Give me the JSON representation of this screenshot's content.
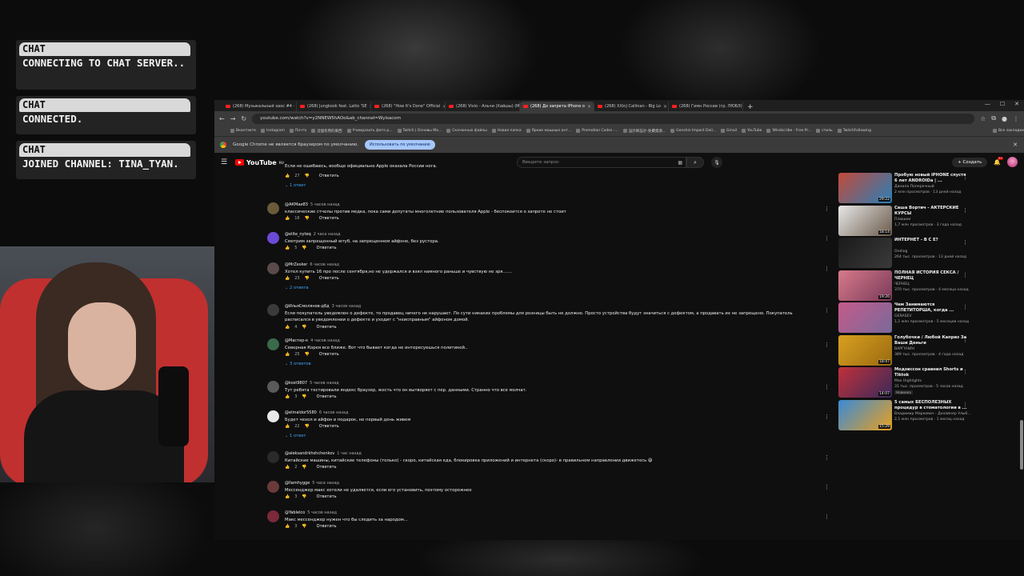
{
  "chat": [
    {
      "tag": "CHAT",
      "message": "CONNECTING TO CHAT SERVER.."
    },
    {
      "tag": "CHAT",
      "message": "CONNECTED."
    },
    {
      "tag": "CHAT",
      "message": "JOINED CHANNEL: TINA_TYAN."
    }
  ],
  "browser": {
    "tabs": [
      {
        "label": "(268) Музыкальный хаос #4 ·"
      },
      {
        "label": "(268) Jungkook feat. Latto 'SE"
      },
      {
        "label": "(268) \"How It's Done\" Official"
      },
      {
        "label": "(268) Vivio - Альчи (Хайшы) (M"
      },
      {
        "label": "(268) До запрета iPhone о"
      },
      {
        "label": "(268) XXinJ Callinan - Big Lo"
      },
      {
        "label": "(268) Гимн России (гр. ЛЮБЭ)"
      }
    ],
    "active_tab": 4,
    "url": "youtube.com/watch?v=y2NNEW5hAOo&ab_channel=Wylsacom",
    "bookmarks": [
      "Вконтакте",
      "Instagram",
      "Почта",
      "這個有用的東西",
      "Учимразить фото р...",
      "Twitch | Основы Ма...",
      "Скачанные файлы",
      "Новая папка",
      "Яркие мощные ант...",
      "Promotion Codes -...",
      "設計師設計-免費資源...",
      "Genshin Impact Dail...",
      "Gmail",
      "YouTube",
      "Windscribe - Free Pr...",
      "стиль",
      "TwitchFollowing",
      "Все закладки"
    ],
    "infobar": {
      "text": "Google Chrome не является браузером по умолчанию.",
      "button": "Использовать по умолчанию"
    }
  },
  "youtube": {
    "logo": "YouTube",
    "country": "RU",
    "search_placeholder": "Введите запрос",
    "create_label": "Создать",
    "notification_count": "9+"
  },
  "comments": [
    {
      "author": "",
      "time": "",
      "text": "Если не ошибаюсь, вообще официально Apple оказала России нога.",
      "likes": "27",
      "replies": "1 ответ"
    },
    {
      "author": "@АКМаи83",
      "time": "5 часов назад",
      "text": "классические стчелы против медка, пока сами депутаты многолетние пользователя Apple - беспокоится о запрете не стоит",
      "likes": "16",
      "replies": ""
    },
    {
      "author": "@elite_nyteq",
      "time": "2 часа назад",
      "text": "Смотрим запрещенный ютуб, на запрещенном айфоне, без рустора.",
      "likes": "5",
      "replies": ""
    },
    {
      "author": "@MrZesker",
      "time": "6 часов назад",
      "text": "Хотел купить 16 про после сентября,но не удержался и взял намного раньше и чувствую не зря.......",
      "likes": "23",
      "replies": "2 ответа"
    },
    {
      "author": "@ИльяСмолянов-д6д",
      "time": "3 часов назад",
      "text": "Если покупатель уведомлен о дефекте, то продавец ничего не нарушает. По сути никаких проблемы для розницы быть не должно. Просто устройства будут значиться с дефектом, а продавать их не запрещено. Покупатель расписался в уведомлении о дефекте и уходит с \"неисправным\" айфоном домой.",
      "likes": "4",
      "replies": ""
    },
    {
      "author": "@Мастер-к",
      "time": "4 часов назад",
      "text": "Северная Корея все ближе. Вот что бывает когда не интересуешься политикой..",
      "likes": "25",
      "replies": "3 ответов"
    },
    {
      "author": "@kost9807",
      "time": "5 часов назад",
      "text": "Тут ребята тестировали яндекс браузер, жесть что он вытворяет с пер. данными. Странно что все молчат.",
      "likes": "3",
      "replies": ""
    },
    {
      "author": "@elmaldor5580",
      "time": "6 часов назад",
      "text": "Будет чехол и айфон в подарок, не первый день живем",
      "likes": "22",
      "replies": "1 ответ"
    },
    {
      "author": "@aleksandrkhshchenkov",
      "time": "1 час назад",
      "text": "Китайские машины, китайские телефоны (только) - скоро, китайская еда, блокировка приложений и интернета (скоро)- в правильном направлении движетесь 😅",
      "likes": "2",
      "replies": ""
    },
    {
      "author": "@llamhygge",
      "time": "5 часа назад",
      "text": "Мессенджер макс хотели не удаляется, если его установить, поэтому осторожнее",
      "likes": "3",
      "replies": ""
    },
    {
      "author": "@Yablelco",
      "time": "5 часов назад",
      "text": "Макс мессенджер нужен что бы следить за народом...",
      "likes": "3",
      "replies": ""
    }
  ],
  "reply_label": "Ответить",
  "recommendations": [
    {
      "title": "Пробую новый iPHONE спустя 6 лет ANDROIDa | ...",
      "channel": "Данила Поперечный",
      "meta": "2 млн просмотров · 13 дней назад",
      "duration": "29:22",
      "badge": "",
      "colors": [
        "#c24a3a",
        "#2a7fb8"
      ]
    },
    {
      "title": "Саша Вортич - АКТЕРСКИЕ КУРСЫ",
      "channel": "Плюшки",
      "meta": "1,7 млн просмотров · 3 года назад",
      "duration": "18:14",
      "badge": "",
      "colors": [
        "#e8e8e8",
        "#6a5a4a"
      ]
    },
    {
      "title": "ИНТЕРНЕТ - В С Е?",
      "channel": "Ondiog",
      "meta": "264 тыс. просмотров · 13 дней назад",
      "duration": "",
      "badge": "",
      "colors": [
        "#1a1a1a",
        "#3a3a3a"
      ]
    },
    {
      "title": "ПОЛНАЯ ИСТОРИЯ СЕКСА / ЧЕРНЕЦ",
      "channel": "ЧЕРНЕЦ",
      "meta": "370 тыс. просмотров · 4 месяца назад",
      "duration": "19:26",
      "badge": "",
      "colors": [
        "#d77a8a",
        "#7a3a5a"
      ]
    },
    {
      "title": "Чем Занимаются РЕПЕТИТОРША, когда ...",
      "channel": "GERASEV",
      "meta": "1,1 млн просмотров · 5 месяцев назад",
      "duration": "",
      "badge": "",
      "colors": [
        "#c45a8a",
        "#7a6a9a"
      ]
    },
    {
      "title": "Голубочки / Любой Каприз За Ваши Деньги",
      "channel": "ВАРГУНИН",
      "meta": "389 тыс. просмотров · 4 года назад",
      "duration": "18:47",
      "badge": "",
      "colors": [
        "#d8a020",
        "#9a6a10"
      ]
    },
    {
      "title": "Модзиссон сравнил Shorts и Tiktok",
      "channel": "Max Highlights",
      "meta": "31 тыс. просмотров · 5 часов назад",
      "duration": "14:07",
      "badge": "Новинка",
      "colors": [
        "#c0303a",
        "#3a2a5a"
      ]
    },
    {
      "title": "5 самых БЕСПОЛЕЗНЫХ процедур в стоматологии в ...",
      "channel": "Владимир Маркевич - Дизайнер Улыб...",
      "meta": "2,1 млн просмотров · 1 месяц назад",
      "duration": "15:29",
      "badge": "",
      "colors": [
        "#3a8ad8",
        "#e8a020"
      ]
    }
  ]
}
